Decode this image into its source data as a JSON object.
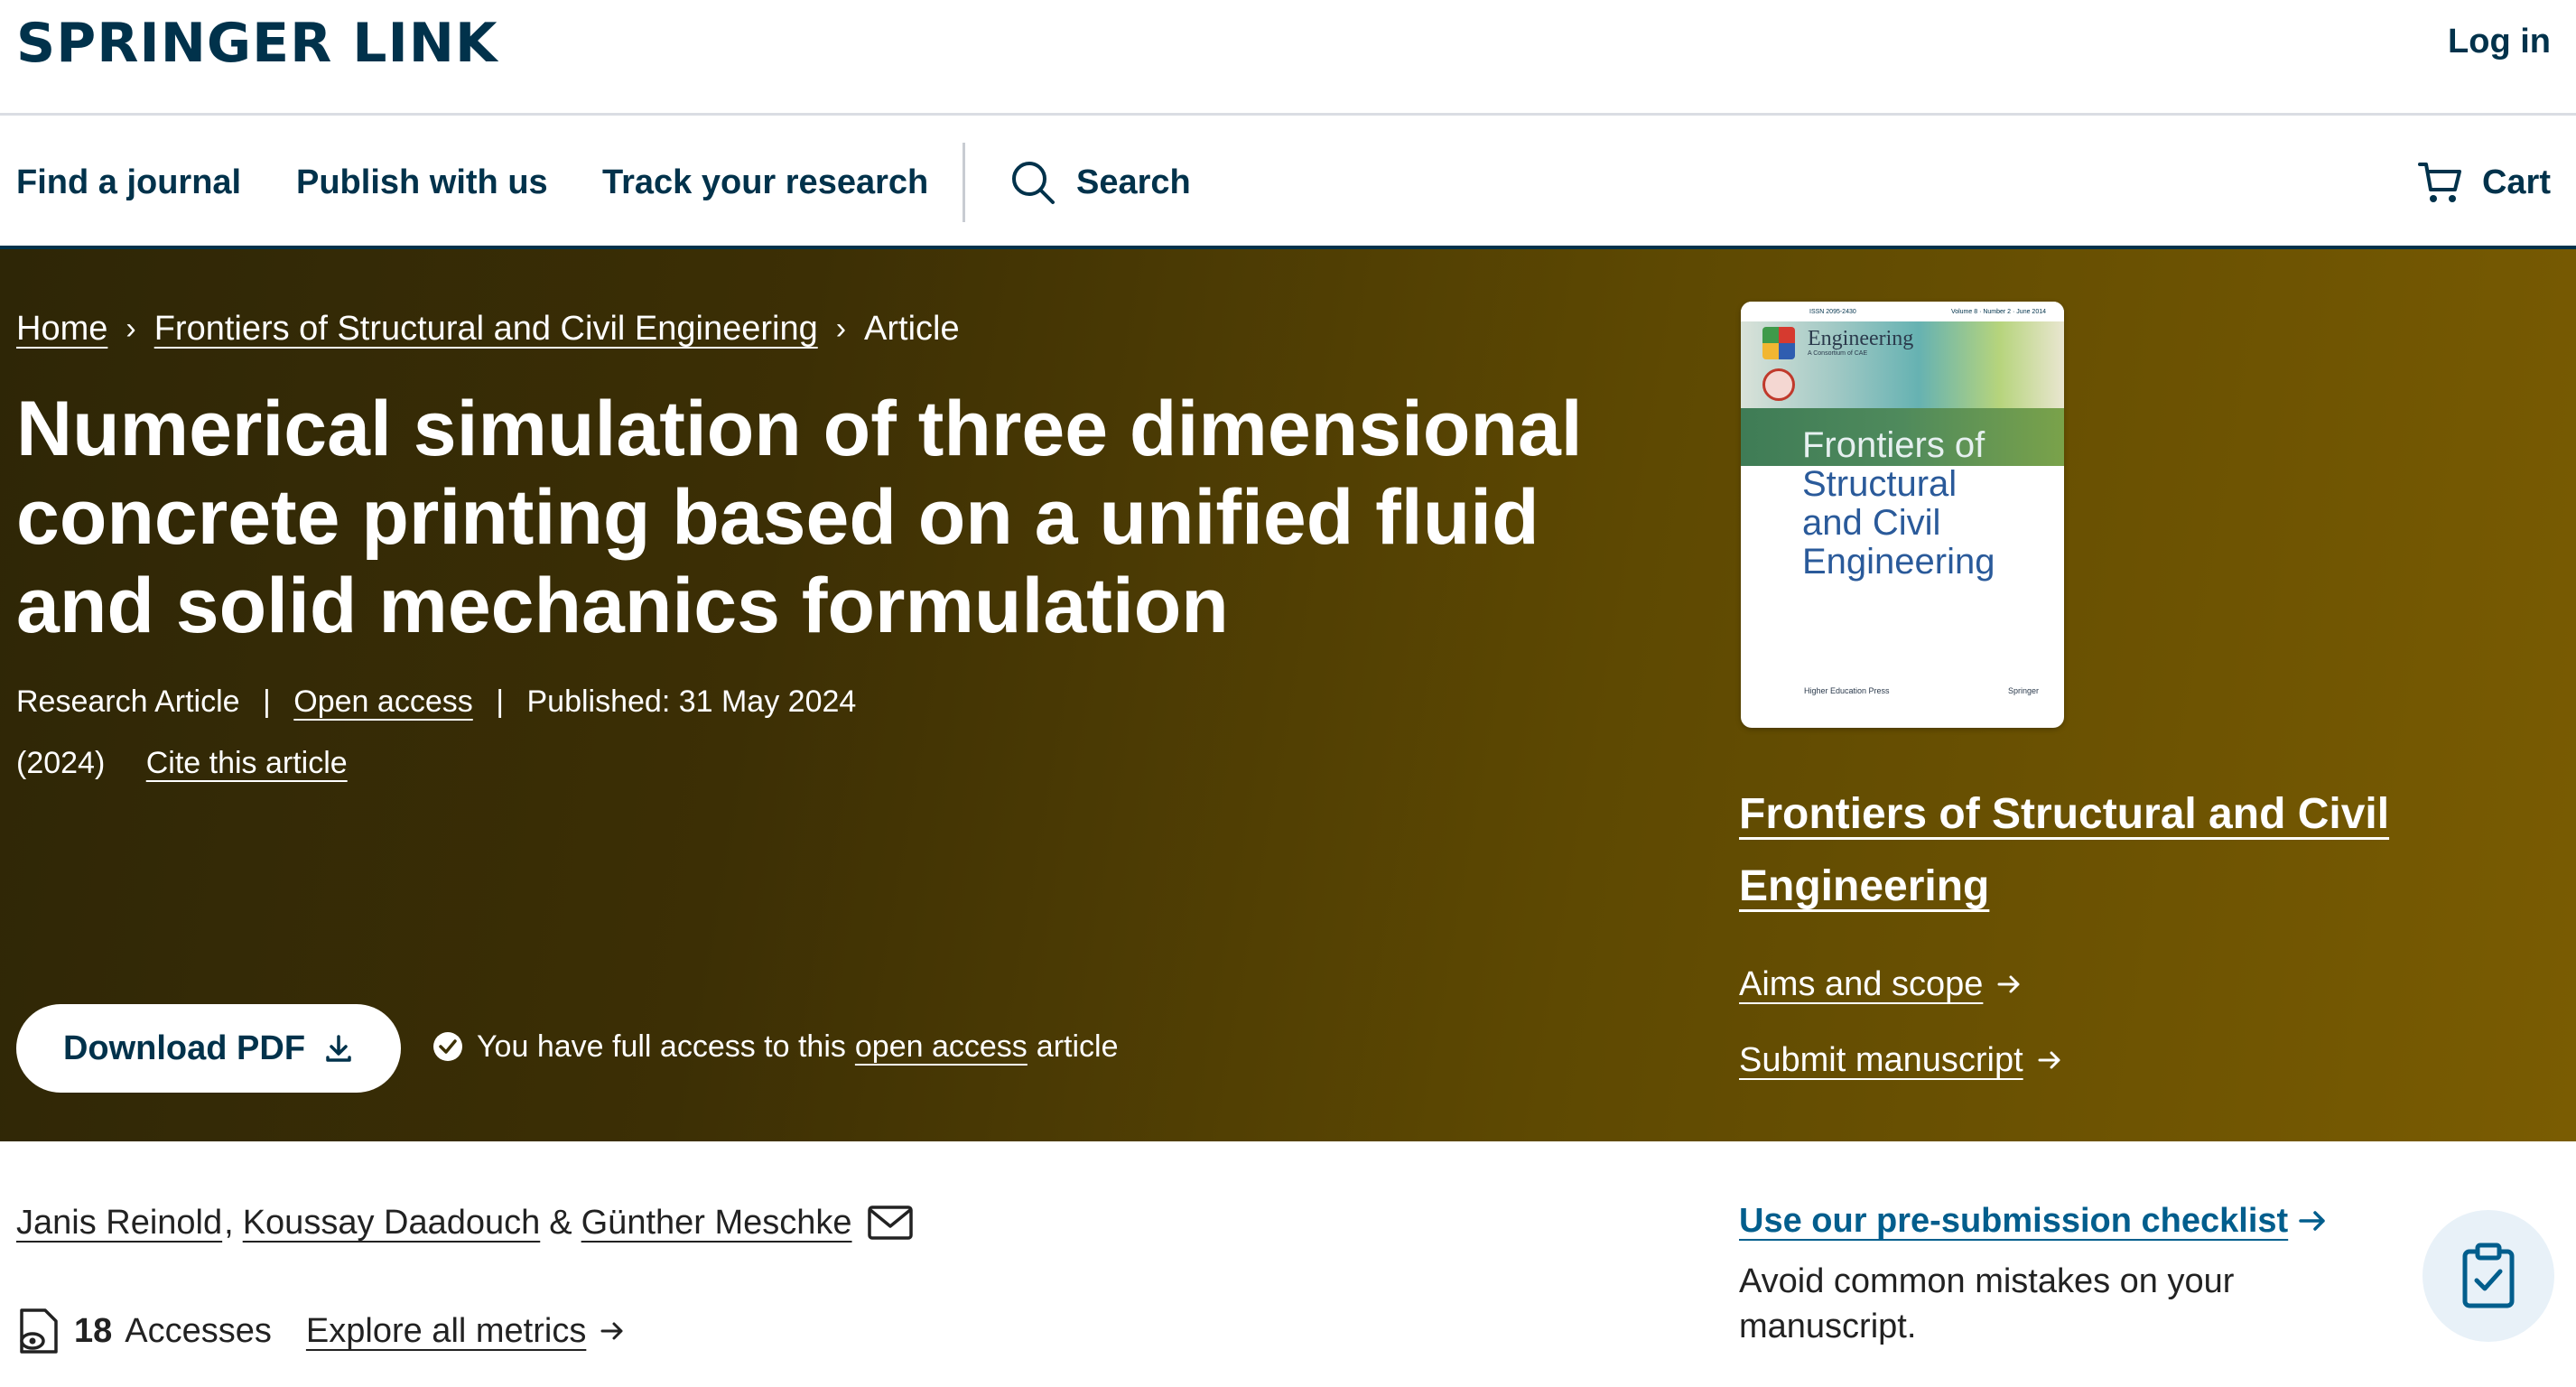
{
  "header": {
    "logo_main": "SPRINGER LINK",
    "login_label": "Log in"
  },
  "nav": {
    "find_journal": "Find a journal",
    "publish": "Publish with us",
    "track": "Track your research",
    "search": "Search",
    "cart": "Cart"
  },
  "breadcrumb": {
    "home": "Home",
    "journal": "Frontiers of Structural and Civil Engineering",
    "current": "Article"
  },
  "article": {
    "title": "Numerical simulation of three dimensional concrete printing based on a unified fluid and solid mechanics formulation",
    "type": "Research Article",
    "open_access": "Open access",
    "published": "Published: 31 May 2024",
    "year": "(2024)",
    "cite": "Cite this article",
    "download_label": "Download PDF",
    "access_prefix": "You have full access to this",
    "access_link": "open access",
    "access_suffix": "article"
  },
  "cover": {
    "issn": "ISSN 2095-2430",
    "volume": "Volume 8 · Number 2 · June 2014",
    "engineering": "Engineering",
    "engineering_sub": "A Consortium of CAE",
    "title_line1": "Frontiers of",
    "title_line2": "Structural",
    "title_line3": "and Civil",
    "title_line4": "Engineering",
    "publisher1": "Higher Education Press",
    "publisher2": "Springer"
  },
  "sidebar": {
    "journal_name": "Frontiers of Structural and Civil Engineering",
    "aims": "Aims and scope",
    "submit": "Submit manuscript",
    "checklist_link": "Use our pre-submission checklist",
    "checklist_desc": "Avoid common mistakes on your manuscript."
  },
  "authors": {
    "a1": "Janis Reinold",
    "a2": "Koussay Daadouch",
    "amp": "&",
    "a3": "Günther Meschke"
  },
  "metrics": {
    "accesses_count": "18",
    "accesses_label": "Accesses",
    "explore": "Explore all metrics"
  },
  "colors": {
    "brand_navy": "#01324b",
    "link_blue": "#025e8d",
    "hero_start": "#2e2606",
    "hero_end": "#7a5c02"
  }
}
